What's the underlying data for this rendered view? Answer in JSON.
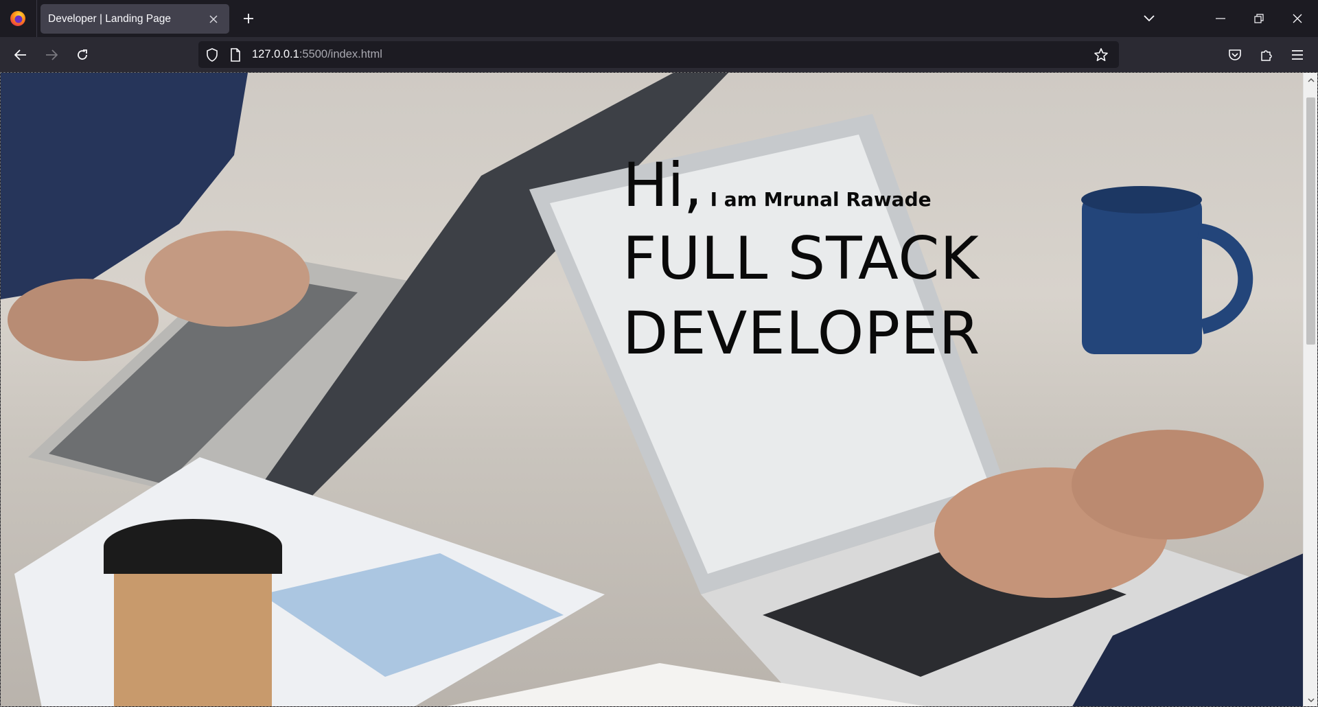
{
  "browser": {
    "tab": {
      "title": "Developer | Landing Page"
    },
    "address": {
      "host": "127.0.0.1",
      "path": ":5500/index.html"
    }
  },
  "page": {
    "greeting": "Hi,",
    "intro": "I am Mrunal Rawade",
    "role_line1": "FULL STACK",
    "role_line2": "DEVELOPER"
  },
  "colors": {
    "tab_strip": "#1c1b22",
    "nav_bar": "#2b2a33",
    "active_tab": "#42414d",
    "hero_text": "#0a0a0a"
  }
}
